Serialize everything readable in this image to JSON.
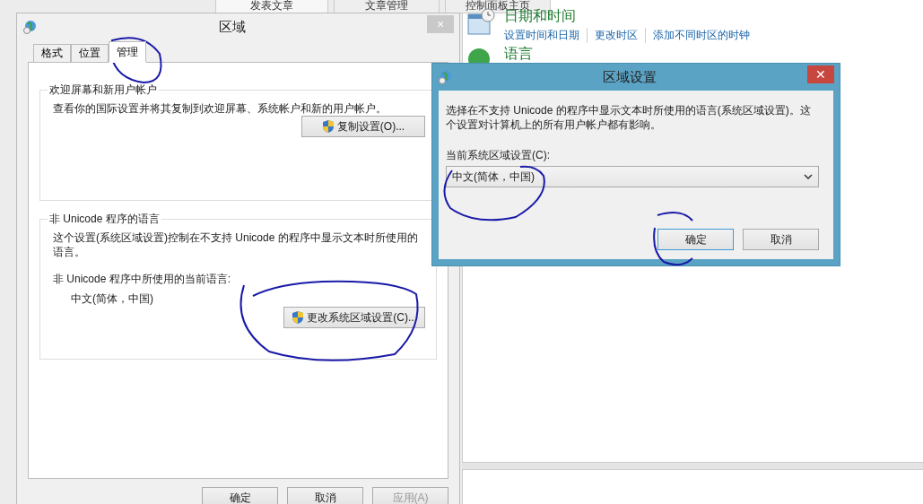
{
  "background_tabs": [
    {
      "label": "发表文章",
      "selected": true
    },
    {
      "label": "文章管理",
      "selected": false
    },
    {
      "label": "控制面板主页",
      "selected": false
    }
  ],
  "control_panel": {
    "sections": [
      {
        "title": "日期和时间",
        "links": [
          "设置时间和日期",
          "更改时区",
          "添加不同时区的时钟"
        ]
      },
      {
        "title": "语言"
      }
    ]
  },
  "region_dialog": {
    "title": "区域",
    "close": "×",
    "tabs": [
      {
        "label": "格式",
        "selected": false
      },
      {
        "label": "位置",
        "selected": false
      },
      {
        "label": "管理",
        "selected": true
      }
    ],
    "groups": [
      {
        "legend": "欢迎屏幕和新用户帐户",
        "text": "查看你的国际设置并将其复制到欢迎屏幕、系统帐户和新的用户帐户。",
        "button": "复制设置(O)..."
      },
      {
        "legend": "非 Unicode 程序的语言",
        "text": "这个设置(系统区域设置)控制在不支持 Unicode 的程序中显示文本时所使用的语言。",
        "current_label": "非 Unicode 程序中所使用的当前语言:",
        "current_value": "中文(简体，中国)",
        "button": "更改系统区域设置(C)..."
      }
    ],
    "buttons": [
      {
        "label": "确定",
        "disabled": false
      },
      {
        "label": "取消",
        "disabled": false
      },
      {
        "label": "应用(A)",
        "disabled": true
      }
    ]
  },
  "locale_dialog": {
    "title": "区域设置",
    "close": "✕",
    "text": "选择在不支持 Unicode 的程序中显示文本时所使用的语言(系统区域设置)。这个设置对计算机上的所有用户帐户都有影响。",
    "field_label": "当前系统区域设置(C):",
    "value": "中文(简体，中国)",
    "buttons": [
      {
        "label": "确定",
        "default": true
      },
      {
        "label": "取消",
        "default": false
      }
    ]
  }
}
